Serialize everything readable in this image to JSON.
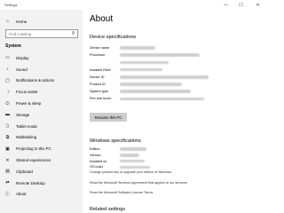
{
  "window": {
    "title": "Settings",
    "minimize": "—",
    "maximize": "☐",
    "close": "✕"
  },
  "sidebar": {
    "home": {
      "icon": "home-icon",
      "glyph": "⌂",
      "label": "Home"
    },
    "search": {
      "placeholder": "Find a setting",
      "icon": "search-icon",
      "glyph": "⚲"
    },
    "section_title": "System",
    "items": [
      {
        "name": "display",
        "icon": "display-icon",
        "glyph": "▭",
        "label": "Display"
      },
      {
        "name": "sound",
        "icon": "speaker-icon",
        "glyph": "♪",
        "label": "Sound"
      },
      {
        "name": "notifications",
        "icon": "notification-icon",
        "glyph": "▢",
        "label": "Notifications & actions"
      },
      {
        "name": "focus-assist",
        "icon": "moon-icon",
        "glyph": "☽",
        "label": "Focus assist"
      },
      {
        "name": "power-sleep",
        "icon": "power-icon",
        "glyph": "⏻",
        "label": "Power & sleep"
      },
      {
        "name": "storage",
        "icon": "storage-icon",
        "glyph": "▬",
        "label": "Storage"
      },
      {
        "name": "tablet-mode",
        "icon": "tablet-icon",
        "glyph": "▯",
        "label": "Tablet mode"
      },
      {
        "name": "multitasking",
        "icon": "multitasking-icon",
        "glyph": "⧉",
        "label": "Multitasking"
      },
      {
        "name": "projecting",
        "icon": "projector-icon",
        "glyph": "▣",
        "label": "Projecting to this PC"
      },
      {
        "name": "shared-experiences",
        "icon": "share-icon",
        "glyph": "✕",
        "label": "Shared experiences"
      },
      {
        "name": "clipboard",
        "icon": "clipboard-icon",
        "glyph": "▤",
        "label": "Clipboard"
      },
      {
        "name": "remote-desktop",
        "icon": "remote-desktop-icon",
        "glyph": "⇄",
        "label": "Remote Desktop"
      },
      {
        "name": "about",
        "icon": "info-icon",
        "glyph": "ⓘ",
        "label": "About"
      }
    ]
  },
  "main": {
    "title": "About",
    "device_specs": {
      "heading": "Device specifications",
      "rows": [
        {
          "label": "Device name"
        },
        {
          "label": "Processor"
        },
        {
          "label": ""
        },
        {
          "label": "Installed RAM"
        },
        {
          "label": "Device ID"
        },
        {
          "label": "Product ID"
        },
        {
          "label": "System type"
        },
        {
          "label": "Pen and touch"
        }
      ],
      "rename_button": "Rename this PC"
    },
    "windows_specs": {
      "heading": "Windows specifications",
      "rows": [
        {
          "label": "Edition"
        },
        {
          "label": "Version"
        },
        {
          "label": "Installed on"
        },
        {
          "label": "OS build"
        }
      ],
      "links": [
        "Change product key or upgrade your edition of Windows",
        "Read the Microsoft Services Agreement that applies to our services",
        "Read the Microsoft Software License Terms"
      ]
    },
    "related": {
      "heading": "Related settings"
    }
  }
}
